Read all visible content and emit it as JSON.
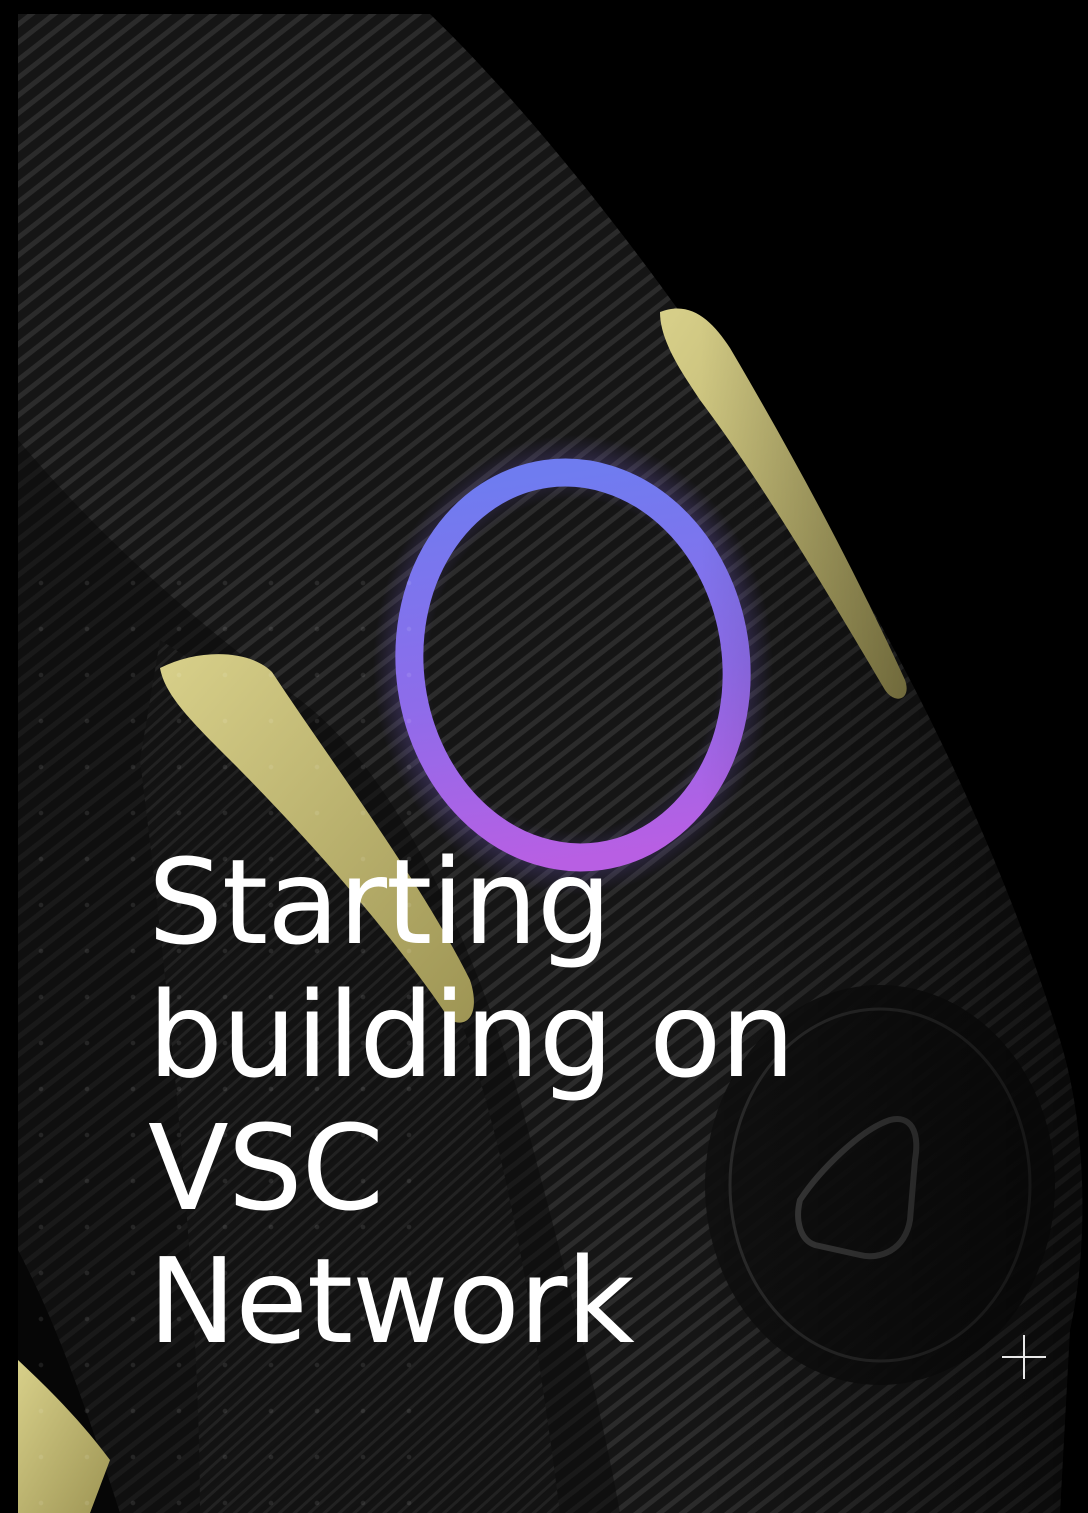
{
  "hero": {
    "headline_lines": [
      "Starting",
      "building on",
      "VSC",
      "Network"
    ]
  },
  "icons": {
    "expand": "plus-icon"
  },
  "colors": {
    "background": "#000000",
    "text": "#ffffff",
    "ring_top": "#6f7cf0",
    "ring_bottom": "#b85fe3",
    "band_body": "#151515",
    "accent_gold": "#c9bf72"
  }
}
